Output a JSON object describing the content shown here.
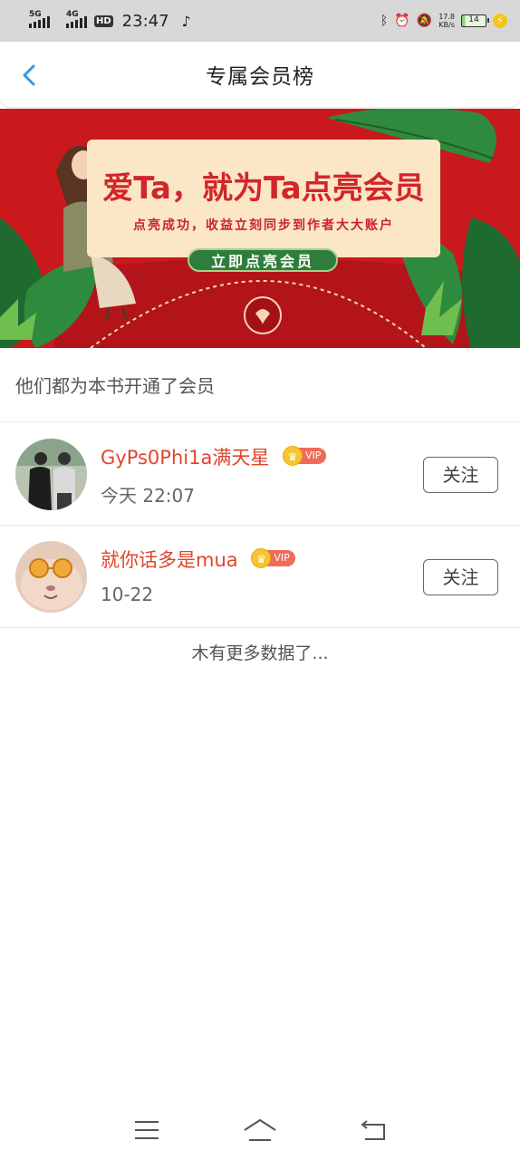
{
  "status_bar": {
    "network1": "5G",
    "network2": "4G",
    "hd": "HD",
    "time": "23:47",
    "speed_value": "17.8",
    "speed_unit": "KB/s",
    "battery": "14"
  },
  "header": {
    "title": "专属会员榜"
  },
  "banner": {
    "title": "爱Ta，就为Ta点亮会员",
    "subtitle": "点亮成功，收益立刻同步到作者大大账户",
    "button_label": "立即点亮会员"
  },
  "section": {
    "heading": "他们都为本书开通了会员"
  },
  "members": [
    {
      "name": "GyPs0Phi1a满天星",
      "badge": "VIP",
      "time": "今天 22:07",
      "follow_label": "关注"
    },
    {
      "name": "就你话多是mua",
      "badge": "VIP",
      "time": "10-22",
      "follow_label": "关注"
    }
  ],
  "footer": {
    "no_more": "木有更多数据了..."
  },
  "colors": {
    "accent": "#2f9bde",
    "banner_red": "#c9191c",
    "name_red": "#e0452b"
  }
}
